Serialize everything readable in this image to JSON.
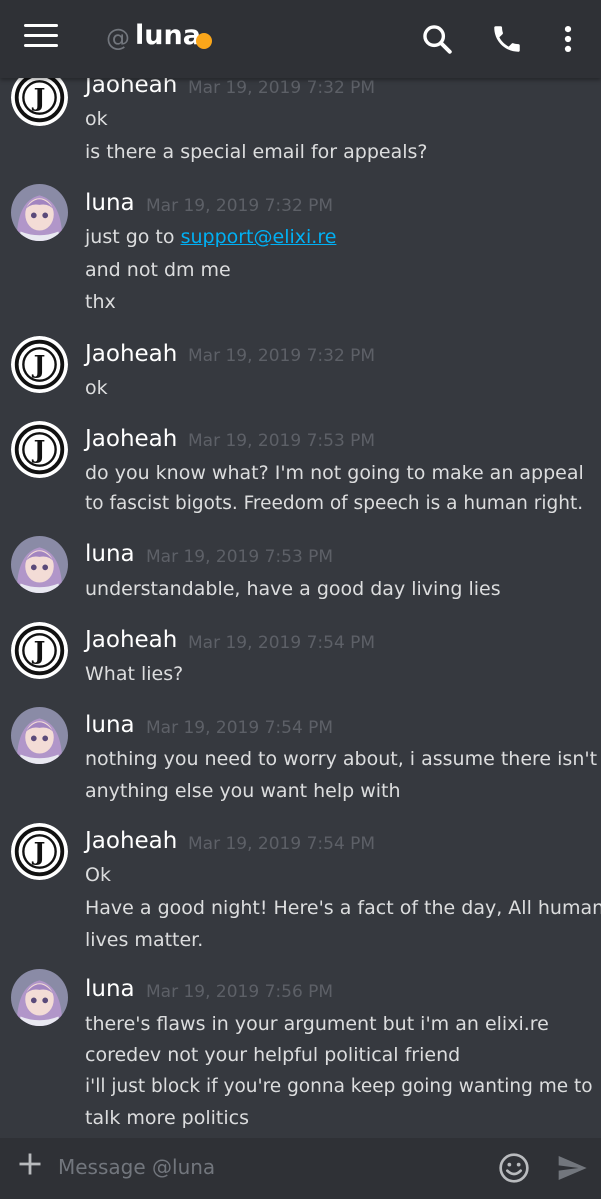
{
  "header": {
    "at": "@",
    "channel": "luna",
    "status_color": "#faa61a",
    "icons": [
      "hamburger-menu-icon",
      "search-icon",
      "phone-call-icon",
      "more-vertical-icon"
    ]
  },
  "messages": [
    {
      "author": "Jaoheah",
      "avatar": "j-logo-avatar",
      "time": "Mar 19, 2019 7:32 PM",
      "lines": [
        "ok",
        "is there a special email for appeals?"
      ]
    },
    {
      "author": "luna",
      "avatar": "anime-girl-avatar",
      "time": "Mar 19, 2019 7:32 PM",
      "link_prefix": "just go to ",
      "link": "support@elixi.re",
      "lines": [
        "and not dm me",
        "thx"
      ]
    },
    {
      "author": "Jaoheah",
      "avatar": "j-logo-avatar",
      "time": "Mar 19, 2019 7:32 PM",
      "lines": [
        "ok"
      ]
    },
    {
      "author": "Jaoheah",
      "avatar": "j-logo-avatar",
      "time": "Mar 19, 2019 7:53 PM",
      "lines": [
        "do you know what? I'm not going to make an appeal",
        "to fascist bigots. Freedom of speech is a human right."
      ]
    },
    {
      "author": "luna",
      "avatar": "anime-girl-avatar",
      "time": "Mar 19, 2019 7:53 PM",
      "lines": [
        "understandable, have a good day living lies"
      ]
    },
    {
      "author": "Jaoheah",
      "avatar": "j-logo-avatar",
      "time": "Mar 19, 2019 7:54 PM",
      "lines": [
        "What lies?"
      ]
    },
    {
      "author": "luna",
      "avatar": "anime-girl-avatar",
      "time": "Mar 19, 2019 7:54 PM",
      "lines": [
        "nothing you need to worry about, i assume there isn't",
        "anything else you want help with"
      ]
    },
    {
      "author": "Jaoheah",
      "avatar": "j-logo-avatar",
      "time": "Mar 19, 2019 7:54 PM",
      "lines": [
        "Ok",
        "Have a good night! Here's a fact of the day, All human",
        "lives matter."
      ]
    },
    {
      "author": "luna",
      "avatar": "anime-girl-avatar",
      "time": "Mar 19, 2019 7:56 PM",
      "lines": [
        "there's flaws in your argument but i'm an elixi.re",
        "coredev not your helpful political friend",
        "i'll just block if you're gonna keep going wanting me to",
        "talk more politics"
      ]
    }
  ],
  "composer": {
    "placeholder": "Message @luna",
    "icons": [
      "plus-icon",
      "emoji-icon",
      "send-icon"
    ]
  }
}
